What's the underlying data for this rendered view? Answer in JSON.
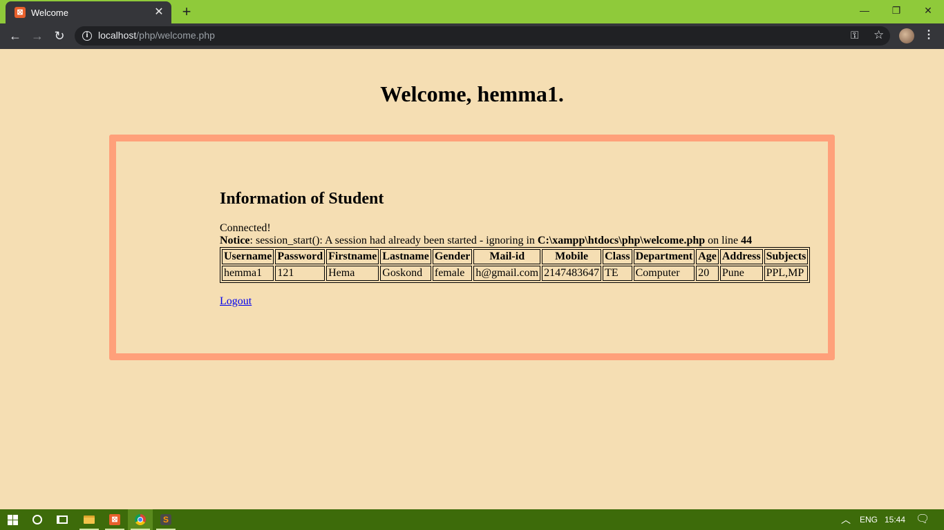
{
  "browser": {
    "tab_title": "Welcome",
    "tab_favicon": "xampp-icon",
    "url_host": "localhost",
    "url_path": "/php/welcome.php",
    "tab_bar_color": "#8fca3a"
  },
  "page": {
    "heading": "Welcome, hemma1.",
    "section_heading": "Information of Student",
    "connected_text": "Connected!",
    "notice": {
      "label": "Notice",
      "message_pre": ": session_start(): A session had already been started - ignoring in ",
      "file_path": "C:\\xampp\\htdocs\\php\\welcome.php",
      "message_mid": " on line ",
      "line_number": "44"
    },
    "table": {
      "headers": [
        "Username",
        "Password",
        "Firstname",
        "Lastname",
        "Gender",
        "Mail-id",
        "Mobile",
        "Class",
        "Department",
        "Age",
        "Address",
        "Subjects"
      ],
      "rows": [
        [
          "hemma1",
          "121",
          "Hema",
          "Goskond",
          "female",
          "h@gmail.com",
          "2147483647",
          "TE",
          "Computer",
          "20",
          "Pune",
          "PPL,MP"
        ]
      ]
    },
    "logout_label": "Logout",
    "background_color": "#f5deb3",
    "box_border_color": "#ffa07a"
  },
  "taskbar": {
    "language": "ENG",
    "time": "15:44",
    "color": "#3d6b0a"
  }
}
